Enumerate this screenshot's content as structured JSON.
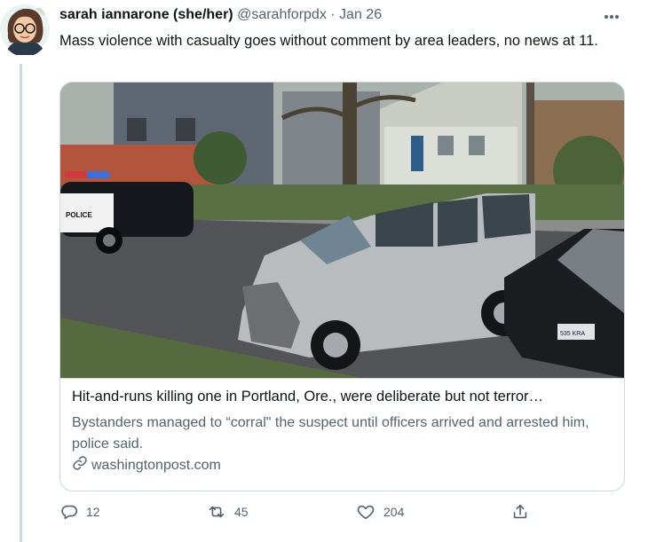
{
  "tweet": {
    "author_name": "sarah iannarone (she/her)",
    "author_handle": "@sarahforpdx",
    "separator": "·",
    "date": "Jan 26",
    "text": "Mass violence with casualty goes without comment by area leaders, no news at 11."
  },
  "card": {
    "title": "Hit-and-runs killing one in Portland, Ore., were deliberate but not terror…",
    "description": "Bystanders managed to “corral\" the suspect until officers arrived and arrested him, police said.",
    "domain": "washingtonpost.com",
    "police_text": "POLICE",
    "plate_text": "535 KRA"
  },
  "actions": {
    "replies": "12",
    "retweets": "45",
    "likes": "204"
  },
  "icons": [
    "more-icon",
    "reply-icon",
    "retweet-icon",
    "like-icon",
    "share-icon",
    "link-icon"
  ],
  "colors": {
    "text": "#0f1419",
    "muted": "#536471",
    "border": "#cfd9de"
  }
}
